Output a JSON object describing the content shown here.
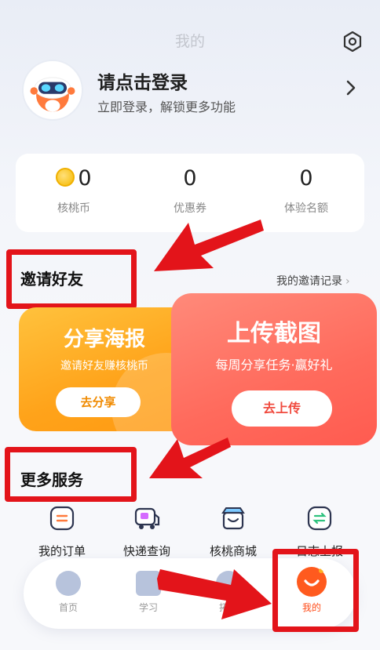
{
  "header": {
    "title": "我的",
    "settings_icon": "gear-icon"
  },
  "profile": {
    "title": "请点击登录",
    "subtitle": "立即登录，解锁更多功能"
  },
  "stats": [
    {
      "value": "0",
      "label": "核桃币",
      "icon": "coin-icon"
    },
    {
      "value": "0",
      "label": "优惠券"
    },
    {
      "value": "0",
      "label": "体验名额"
    }
  ],
  "invite": {
    "title": "邀请好友",
    "record_link": "我的邀请记录",
    "share_card": {
      "title": "分享海报",
      "subtitle": "邀请好友赚核桃币",
      "button": "去分享"
    },
    "upload_card": {
      "title": "上传截图",
      "subtitle": "每周分享任务·赢好礼",
      "button": "去上传"
    }
  },
  "services": {
    "title": "更多服务",
    "items": [
      {
        "label": "我的订单",
        "icon": "order-icon"
      },
      {
        "label": "快递查询",
        "icon": "delivery-icon"
      },
      {
        "label": "核桃商城",
        "icon": "shop-icon"
      },
      {
        "label": "日志上报",
        "icon": "log-upload-icon"
      }
    ]
  },
  "tabbar": [
    {
      "label": "首页",
      "icon": "home-icon"
    },
    {
      "label": "学习",
      "icon": "study-icon"
    },
    {
      "label": "拓展",
      "icon": "expand-icon"
    },
    {
      "label": "我的",
      "icon": "profile-icon",
      "active": true
    }
  ],
  "colors": {
    "accent": "#ff5a1e",
    "annotation_red": "#e3141a",
    "share_orange": "#ffa31a",
    "upload_red": "#ff6a5c"
  }
}
